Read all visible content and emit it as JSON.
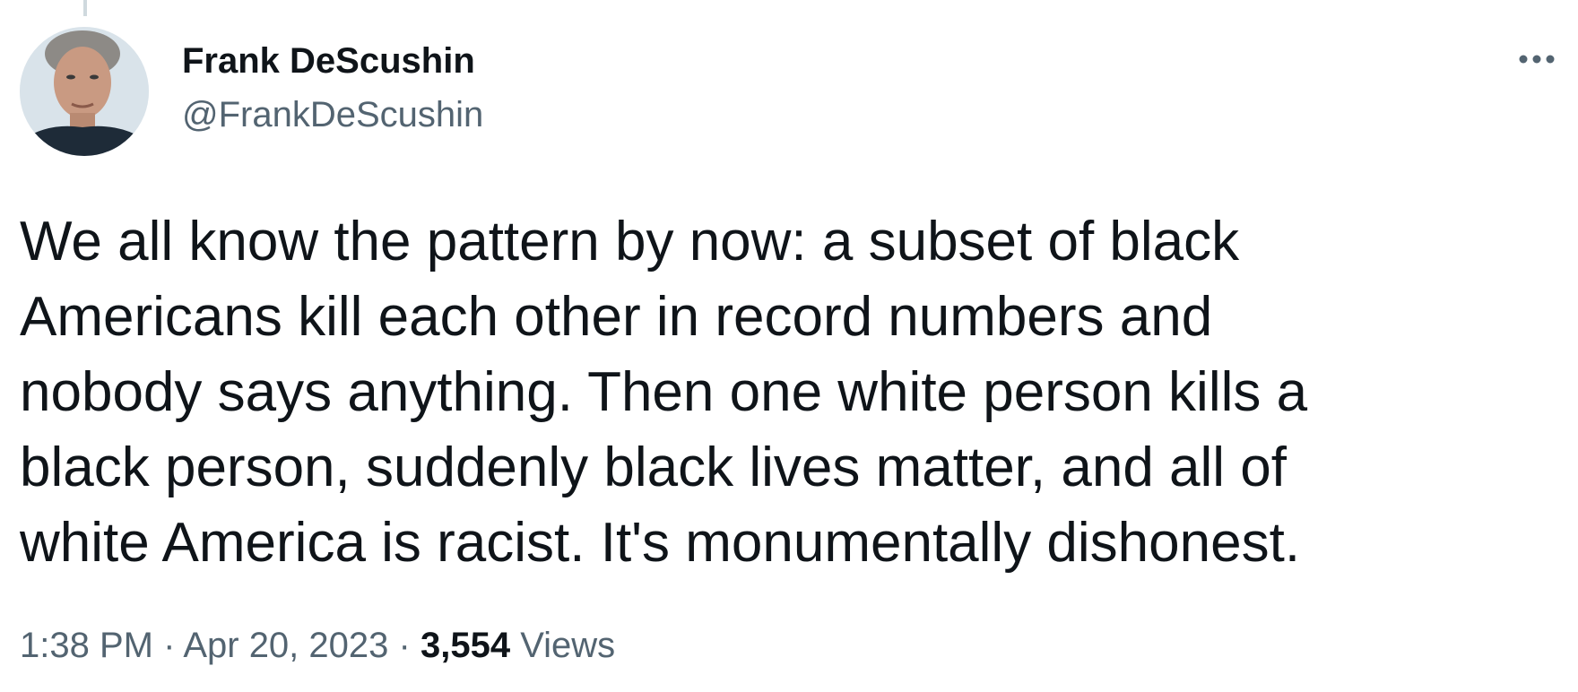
{
  "author": {
    "display_name": "Frank DeScushin",
    "handle": "@FrankDeScushin",
    "avatar_icon": "profile-photo"
  },
  "menu": {
    "more_icon": "ellipsis-icon"
  },
  "tweet": {
    "text_lines": [
      "We all know the pattern by now: a subset of black",
      "Americans kill each other in record numbers and",
      "nobody says anything. Then one white person kills a",
      "black person, suddenly black lives matter, and all of",
      "white America is racist. It's monumentally dishonest."
    ]
  },
  "meta": {
    "time": "1:38 PM",
    "separator": "·",
    "date": "Apr 20, 2023",
    "views_count": "3,554",
    "views_label": "Views"
  },
  "colors": {
    "text_primary": "#0f1419",
    "text_secondary": "#536471",
    "thread_line": "#cfd9de",
    "background": "#ffffff"
  }
}
